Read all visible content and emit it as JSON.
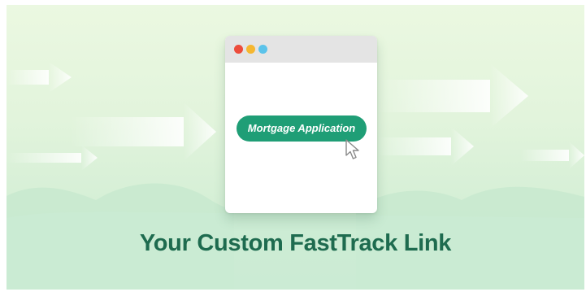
{
  "browser_window": {
    "controls": [
      {
        "name": "close",
        "color": "#ec4c3c"
      },
      {
        "name": "minimize",
        "color": "#f5b731"
      },
      {
        "name": "maximize",
        "color": "#5bc3ea"
      }
    ],
    "button": {
      "label": "Mortgage Application",
      "color": "#1f9e76"
    },
    "cursor_icon": "pointer-arrow-icon"
  },
  "headline": {
    "text": "Your Custom FastTrack Link",
    "color": "#1e6b4f"
  },
  "background": {
    "top_color": "#ebf8e1",
    "bottom_color": "#cdebd4",
    "decoration": "motion-arrows"
  }
}
